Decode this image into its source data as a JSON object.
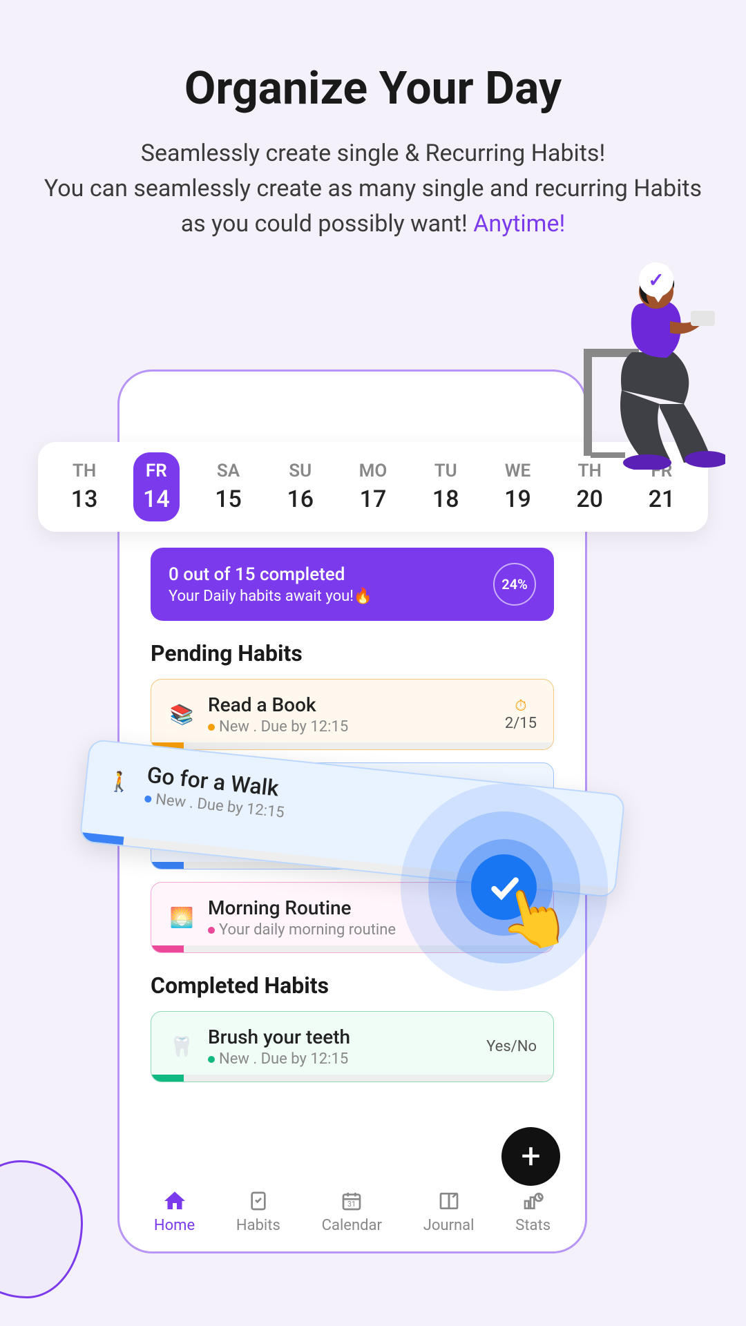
{
  "hero": {
    "title": "Organize Your Day",
    "line1": "Seamlessly create single & Recurring Habits!",
    "line2a": "You can seamlessly create as many single and recurring Habits as you could possibly want! ",
    "accent": "Anytime!"
  },
  "week": [
    {
      "name": "TH",
      "num": "13",
      "active": false
    },
    {
      "name": "FR",
      "num": "14",
      "active": true
    },
    {
      "name": "SA",
      "num": "15",
      "active": false
    },
    {
      "name": "SU",
      "num": "16",
      "active": false
    },
    {
      "name": "MO",
      "num": "17",
      "active": false
    },
    {
      "name": "TU",
      "num": "18",
      "active": false
    },
    {
      "name": "WE",
      "num": "19",
      "active": false
    },
    {
      "name": "TH",
      "num": "20",
      "active": false
    },
    {
      "name": "FR",
      "num": "21",
      "active": false
    }
  ],
  "progress": {
    "text": "0 out of 15 completed",
    "sub": "Your Daily habits await you!🔥",
    "pct": "24%"
  },
  "sections": {
    "pending": "Pending Habits",
    "completed": "Completed  Habits"
  },
  "habits": {
    "read": {
      "title": "Read a Book",
      "meta": "New . Due by 12:15",
      "count": "2/15",
      "timerIcon": "⏱"
    },
    "walk": {
      "title": "Go for a Walk",
      "meta": "New . Due by 12:15"
    },
    "morning": {
      "title": "Morning Routine",
      "meta": "Your daily morning routine"
    },
    "brush": {
      "title": "Brush your teeth",
      "meta": "New . Due by 12:15",
      "right": "Yes/No"
    }
  },
  "nav": [
    {
      "label": "Home",
      "active": true
    },
    {
      "label": "Habits",
      "active": false
    },
    {
      "label": "Calendar",
      "active": false
    },
    {
      "label": "Journal",
      "active": false
    },
    {
      "label": "Stats",
      "active": false
    }
  ],
  "fab": "+"
}
